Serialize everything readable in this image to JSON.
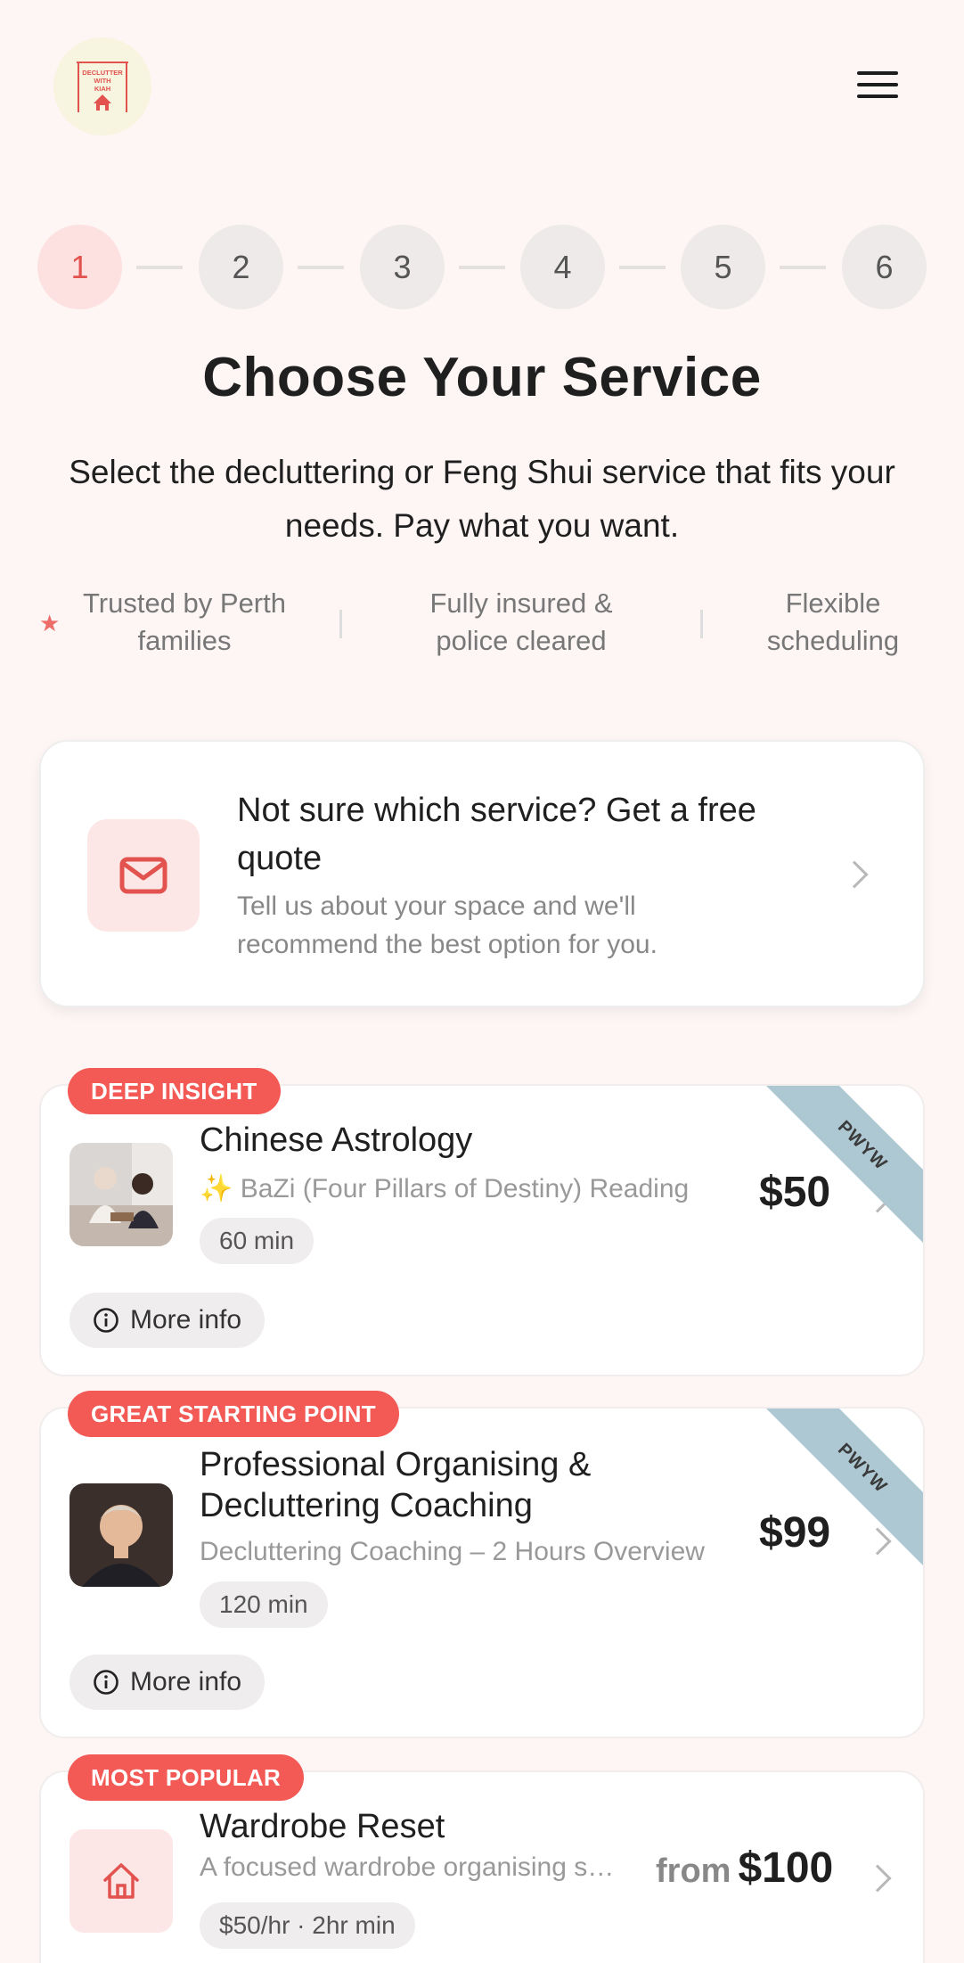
{
  "header": {
    "logo_text": "DECLUTTER WITH KIAH",
    "menu_icon": "hamburger-menu-icon"
  },
  "stepper": {
    "steps": [
      "1",
      "2",
      "3",
      "4",
      "5",
      "6"
    ],
    "active_step": 1
  },
  "page": {
    "title": "Choose Your Service",
    "subtitle": "Select the decluttering or Feng Shui service that fits your needs. Pay what you want."
  },
  "trust": {
    "items": [
      "Trusted by Perth families",
      "Fully insured & police cleared",
      "Flexible scheduling"
    ]
  },
  "quote_card": {
    "title": "Not sure which service? Get a free quote",
    "description": "Tell us about your space and we'll recommend the best option for you."
  },
  "services": [
    {
      "badge": "DEEP INSIGHT",
      "name": "Chinese Astrology",
      "description": "BaZi (Four Pillars of Destiny) Reading",
      "duration": "60 min",
      "price": "$50",
      "ribbon": "PWYW",
      "more_info": "More info"
    },
    {
      "badge": "GREAT STARTING POINT",
      "name": "Professional Organising & Decluttering Coaching",
      "description": "Decluttering Coaching – 2 Hours Overview",
      "duration": "120 min",
      "price": "$99",
      "ribbon": "PWYW",
      "more_info": "More info"
    },
    {
      "badge": "MOST POPULAR",
      "name": "Wardrobe Reset",
      "description": "A focused wardrobe organising session",
      "duration": "$50/hr · 2hr min",
      "price_prefix": "from",
      "price": "$100"
    }
  ],
  "colors": {
    "accent": "#f35a55",
    "background": "#fdf6f5",
    "ribbon": "#aec8d3"
  }
}
